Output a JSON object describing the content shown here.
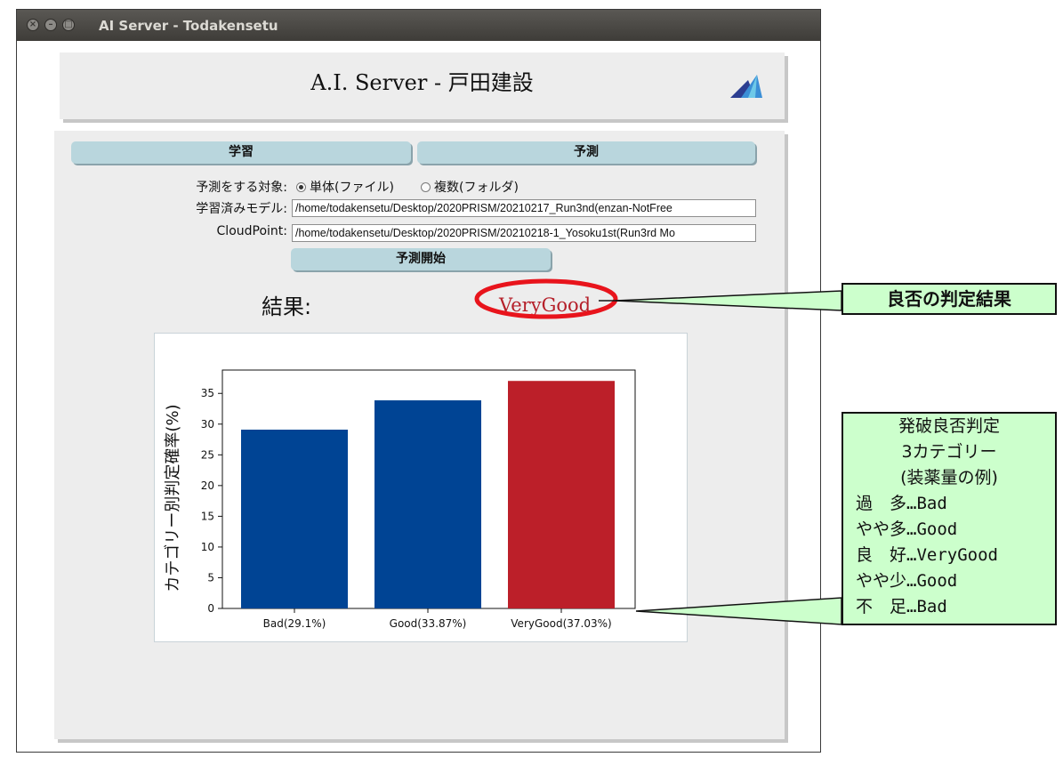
{
  "window": {
    "title": "AI Server - Todakensetu"
  },
  "header": {
    "title": "A.I. Server - 戸田建設",
    "logo_icon": "mountain-logo-icon"
  },
  "tabs": {
    "train_label": "学習",
    "predict_label": "予測"
  },
  "form": {
    "target_label": "予測をする対象:",
    "radio_single_label": "単体(ファイル)",
    "radio_multi_label": "複数(フォルダ)",
    "selected_target": "単体(ファイル)",
    "model_label": "学習済みモデル:",
    "model_value": "/home/todakensetu/Desktop/2020PRISM/20210217_Run3nd(enzan-NotFree",
    "cloud_label": "CloudPoint:",
    "cloud_value": "/home/todakensetu/Desktop/2020PRISM/20210218-1_Yosoku1st(Run3rd Mo",
    "start_label": "予測開始"
  },
  "result": {
    "label": "結果:",
    "value": "VeryGood",
    "color": "#b5202a"
  },
  "chart_data": {
    "type": "bar",
    "categories": [
      "Bad(29.1%)",
      "Good(33.87%)",
      "VeryGood(37.03%)"
    ],
    "values": [
      29.1,
      33.87,
      37.03
    ],
    "colors": [
      "#004494",
      "#004494",
      "#bc1f29"
    ],
    "ylabel": "カテゴリー別判定確率(%)",
    "xlabel": "",
    "ylim": [
      0,
      38.8
    ],
    "yticks": [
      0,
      5,
      10,
      15,
      20,
      25,
      30,
      35
    ],
    "grid": false
  },
  "callouts": {
    "result_note": "良否の判定結果",
    "category_title_1": "発破良否判定",
    "category_title_2": "3カテゴリー",
    "category_title_3": "(装薬量の例)",
    "category_lines": [
      "過　多…Bad",
      "やや多…Good",
      "良　好…VeryGood",
      "やや少…Good",
      "不　足…Bad"
    ]
  }
}
